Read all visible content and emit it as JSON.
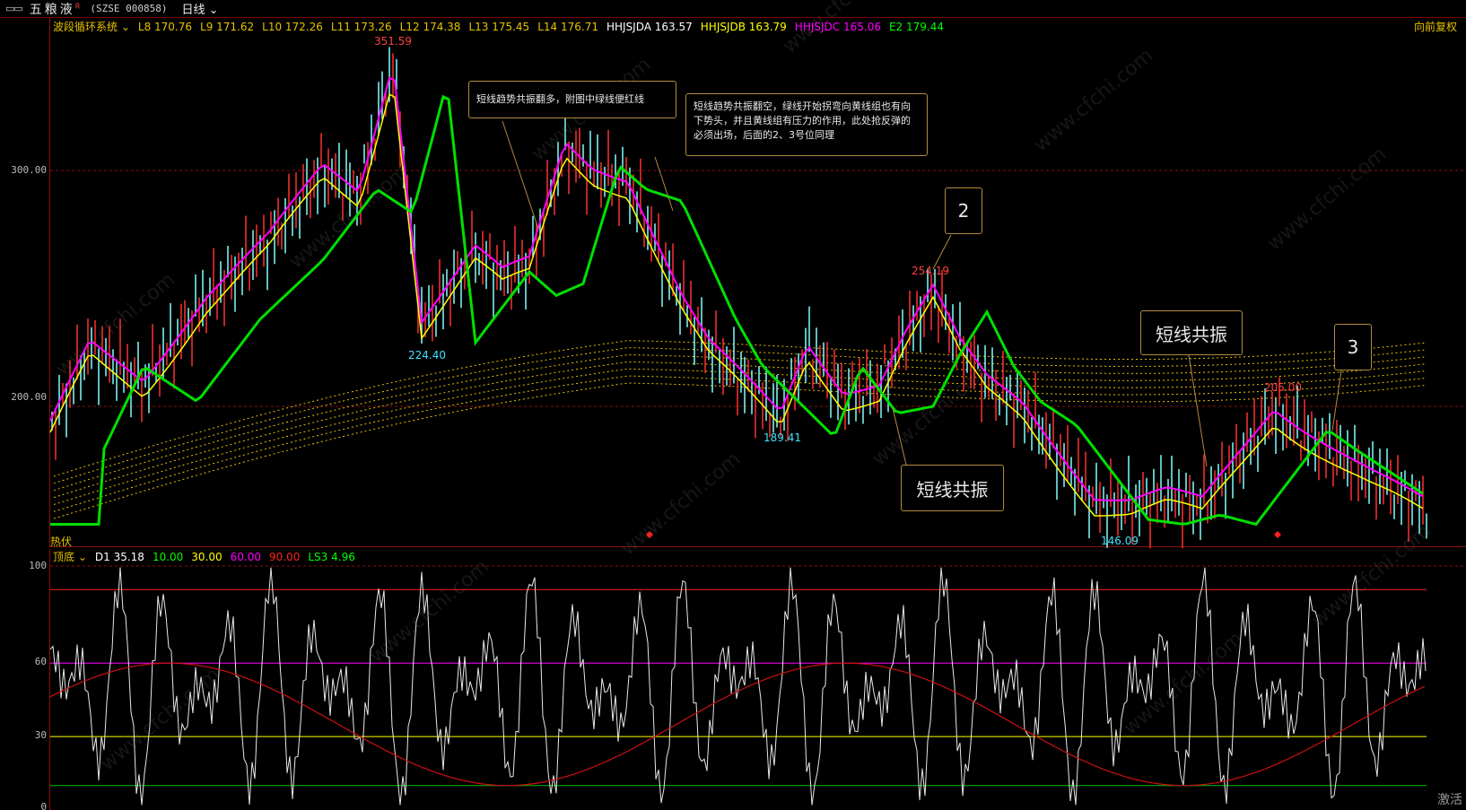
{
  "window": {
    "menu_icon": "▭▭",
    "stock_name": "五粮液",
    "stock_name_sup": "R",
    "stock_code": "(SZSE 000858)",
    "period": "日线"
  },
  "main_indicator": {
    "name": "波段循环系统",
    "items": [
      {
        "label": "L8 170.76",
        "color": "#e6c200"
      },
      {
        "label": "L9 171.62",
        "color": "#e6c200"
      },
      {
        "label": "L10 172.26",
        "color": "#e6c200"
      },
      {
        "label": "L11 173.26",
        "color": "#e6c200"
      },
      {
        "label": "L12 174.38",
        "color": "#e6c200"
      },
      {
        "label": "L13 175.45",
        "color": "#e6c200"
      },
      {
        "label": "L14 176.71",
        "color": "#e6c200"
      },
      {
        "label": "HHJSJDA 163.57",
        "color": "#ffffff"
      },
      {
        "label": "HHJSJDB 163.79",
        "color": "#ffff00"
      },
      {
        "label": "HHJSJDC 165.06",
        "color": "#ff00ff"
      },
      {
        "label": "E2 179.44",
        "color": "#00ff00"
      }
    ],
    "right_label": "向前复权"
  },
  "sub_indicator": {
    "name": "顶底",
    "items": [
      {
        "label": "D1 35.18",
        "color": "#ffffff"
      },
      {
        "label": "10.00",
        "color": "#00ff00"
      },
      {
        "label": "30.00",
        "color": "#ffff00"
      },
      {
        "label": "60.00",
        "color": "#ff00ff"
      },
      {
        "label": "90.00",
        "color": "#ff2020"
      },
      {
        "label": "LS3 4.96",
        "color": "#00ff00"
      }
    ]
  },
  "main_axis": {
    "labels": [
      "300.00",
      "200.00"
    ]
  },
  "sub_axis": {
    "labels": [
      "100",
      "60",
      "30",
      "0"
    ]
  },
  "price_marks": [
    {
      "text": "351.59",
      "color": "#ff4040"
    },
    {
      "text": "224.40",
      "color": "#40e0ff"
    },
    {
      "text": "189.41",
      "color": "#40e0ff"
    },
    {
      "text": "254.19",
      "color": "#ff4040"
    },
    {
      "text": "205.00",
      "color": "#ff4040"
    },
    {
      "text": "146.09",
      "color": "#40e0ff"
    }
  ],
  "callouts": {
    "c1": "短线趋势共振翻多，附图中绿线便红线",
    "c2": "短线趋势共振翻空，绿线开始拐弯向黄线组也有向下势头，并且黄线组有压力的作用，此处抢反弹的必须出场，后面的2、3号位同理",
    "box_2": "2",
    "box_3": "3",
    "resonance_a": "短线共振",
    "resonance_b": "短线共振"
  },
  "bottom_label": "热伏",
  "watermark": "www.cfchi.com",
  "corner_text": "激活",
  "colors": {
    "bull_fill": "#b00000",
    "bear_fill": "#1010ff",
    "e2_line": "#00e000",
    "yellow_line": "#ffff00",
    "magenta_line": "#ff00ff",
    "candle": "#80ffff",
    "grid_red": "#8a1010"
  }
}
